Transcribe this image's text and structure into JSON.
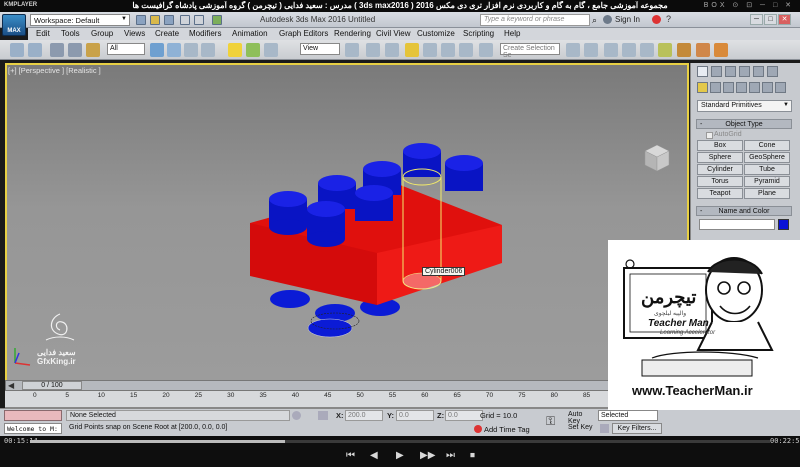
{
  "player": {
    "logo": "KMPLAYER",
    "title": "مجموعه آموزشی جامع ، گام به گام و کاربردی نرم افزار تری دی مکس 2016 ( 3ds max2016 ) مدرس : سعید فدایی ( تیچرمن ) گروه آموزشی پادشاه گرافیست ها",
    "window_controls": "BOX ⊙ ⊡ ─ □ ✕",
    "time_current": "00:15:14",
    "time_total": "00:22:59",
    "progress_fraction": 0.345,
    "controls": [
      "⏮",
      "◀",
      "▶",
      "▶▶",
      "⏭",
      "⏹"
    ]
  },
  "app": {
    "max_logo": "MAX",
    "workspace": "Workspace: Default",
    "title": "Autodesk 3ds Max 2016    Untitled",
    "help_search_placeholder": "Type a keyword or phrase",
    "sign_in": "Sign In",
    "window_buttons": [
      "─",
      "□",
      "✕"
    ]
  },
  "menu": [
    "Edit",
    "Tools",
    "Group",
    "Views",
    "Create",
    "Modifiers",
    "Animation",
    "Graph Editors",
    "Rendering",
    "Civil View",
    "Customize",
    "Scripting",
    "Help"
  ],
  "toolbar": {
    "selection_filter": "All",
    "ref_coord": "View",
    "named_selection_placeholder": "Create Selection Se"
  },
  "viewport": {
    "label": "[+] [Perspective ] [Realistic ]",
    "tooltip": "Cylinder006",
    "accent_color": "#e8d044"
  },
  "command_panel": {
    "category": "Standard Primitives",
    "object_type_title": "Object Type",
    "autogrid": "AutoGrid",
    "buttons": [
      "Box",
      "Cone",
      "Sphere",
      "GeoSphere",
      "Cylinder",
      "Tube",
      "Torus",
      "Pyramid",
      "Teapot",
      "Plane"
    ],
    "name_color_title": "Name and Color",
    "object_color": "#0a12d8",
    "rollout_sign": "-"
  },
  "timeline": {
    "frame_counter": "0 / 100",
    "ticks": [
      "0",
      "5",
      "10",
      "15",
      "20",
      "25",
      "30",
      "35",
      "40",
      "45",
      "50",
      "55",
      "60",
      "65",
      "70",
      "75",
      "80",
      "85",
      "90",
      "95",
      "100"
    ]
  },
  "status": {
    "selection": "None Selected",
    "prompt": "Grid Points snap on Scene Root at [200.0, 0.0, 0.0]",
    "welcome": "Welcome to M:",
    "x_label": "X:",
    "x_value": "200.0",
    "y_label": "Y:",
    "y_value": "0.0",
    "z_label": "Z:",
    "z_value": "0.0",
    "grid": "Grid = 10.0",
    "add_time_tag": "Add Time Tag",
    "auto_key": "Auto Key",
    "set_key": "Set Key",
    "selected_dd": "Selected",
    "key_filters": "Key Filters..."
  },
  "watermarks": {
    "gfx_name": "سعید فدایی",
    "gfx_url": "GfxKing.ir",
    "tm_logo": "تیچرمن",
    "tm_sub": "والپیه لیلچوی",
    "tm_brand": "Teacher Man",
    "tm_sub2": "Learning Accelerator",
    "tm_url": "www.TeacherMan.ir"
  }
}
